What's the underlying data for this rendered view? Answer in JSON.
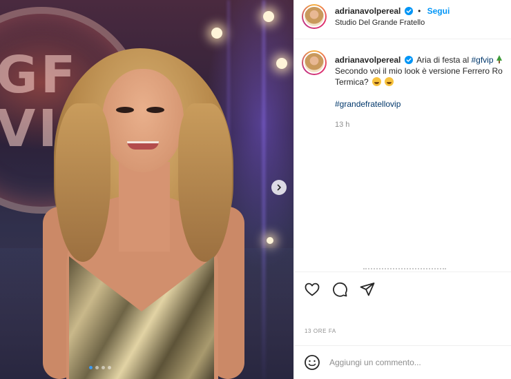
{
  "post": {
    "username": "adrianavolpereal",
    "follow_label": "Segui",
    "separator": "•",
    "location": "Studio Del Grande Fratello",
    "caption": {
      "username": "adrianavolpereal",
      "text_part1": "Aria di festa al",
      "hashtag1": "#gfvip",
      "text_part2": "Secondo voi il mio look è versione Ferrero Ro",
      "text_part3": "Termica?",
      "hashtag2": "#grandefratellovip",
      "time": "13 h"
    },
    "post_time": "13 ORE FA",
    "comment_placeholder": "Aggiungi un commento..."
  },
  "media": {
    "backdrop_text": "GF VIP",
    "carousel_total": 4,
    "carousel_active": 1
  },
  "icons": {
    "verified": "verified-badge-icon",
    "like": "heart-icon",
    "comment": "comment-bubble-icon",
    "share": "paper-plane-icon",
    "emoji": "smiley-face-icon",
    "next": "chevron-right-icon",
    "tree": "christmas-tree-emoji"
  },
  "colors": {
    "accent": "#0095f6",
    "hashtag": "#00376b",
    "muted": "#8e8e8e",
    "carousel_active": "#3f9bf0"
  }
}
